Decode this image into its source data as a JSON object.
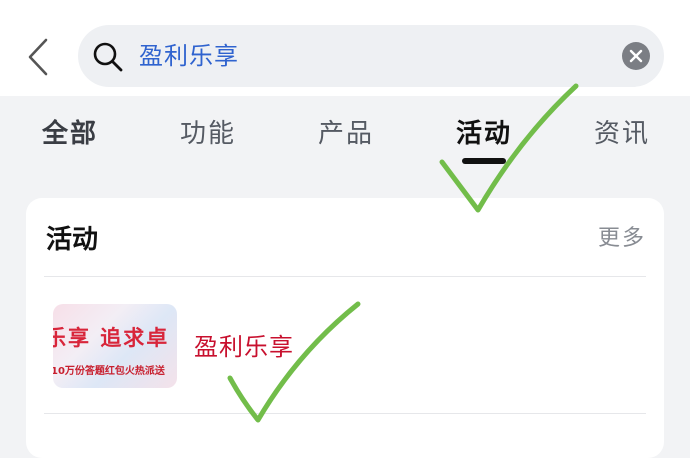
{
  "search": {
    "query": "盈利乐享"
  },
  "tabs": [
    {
      "label": "全部"
    },
    {
      "label": "功能"
    },
    {
      "label": "产品"
    },
    {
      "label": "活动"
    },
    {
      "label": "资讯"
    }
  ],
  "active_tab": "活动",
  "section": {
    "title": "活动",
    "more_label": "更多"
  },
  "results": [
    {
      "thumbnail_text": "乐享 追求卓",
      "thumbnail_subtext": "10万份答题红包火热派送",
      "title": "盈利乐享"
    }
  ],
  "icons": {
    "back": "chevron-left-icon",
    "search": "search-icon",
    "clear": "clear-icon",
    "annotation": "checkmark-icon"
  },
  "colors": {
    "query": "#2f63cf",
    "result_title": "#c8102e",
    "checkmark": "#72bd4a"
  }
}
